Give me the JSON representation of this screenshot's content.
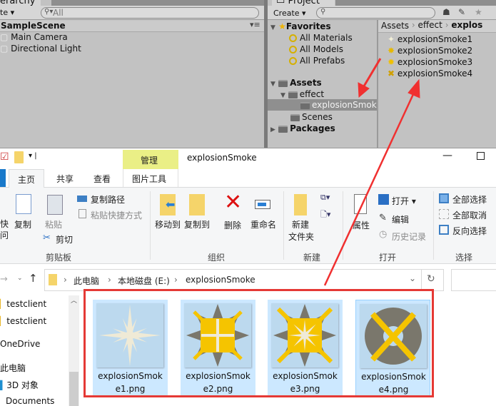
{
  "unity": {
    "hierarchy": {
      "tab_label": "erarchy",
      "create_label": "te ▾",
      "search_placeholder": "All",
      "scene": "SampleScene",
      "items": [
        "Main Camera",
        "Directional Light"
      ]
    },
    "project": {
      "tab_label": "Project",
      "create_label": "Create ▾",
      "tree": {
        "favorites": "Favorites",
        "favorite_items": [
          "All Materials",
          "All Models",
          "All Prefabs"
        ],
        "assets": "Assets",
        "effect": "effect",
        "selected_folder": "explosionSmoke",
        "scenes": "Scenes",
        "packages": "Packages"
      },
      "breadcrumb": [
        "Assets",
        "effect",
        "explos"
      ],
      "files": [
        "explosionSmoke1",
        "explosionSmoke2",
        "explosionSmoke3",
        "explosionSmoke4"
      ]
    }
  },
  "explorer": {
    "title": "explosionSmoke",
    "context_tab": "管理",
    "context_tab_color": "#eaef86",
    "tabs": [
      "主页",
      "共享",
      "查看",
      "图片工具"
    ],
    "ribbon": {
      "clipboard": {
        "label": "剪贴板",
        "pin": "快\n问",
        "copy": "复制",
        "paste": "粘贴",
        "copy_path": "复制路径",
        "paste_shortcut": "粘贴快捷方式",
        "cut": "剪切"
      },
      "organize": {
        "label": "组织",
        "move_to": "移动到",
        "copy_to": "复制到",
        "delete": "删除",
        "rename": "重命名"
      },
      "new": {
        "label": "新建",
        "new_folder_1": "新建",
        "new_folder_2": "文件夹"
      },
      "open": {
        "label": "打开",
        "properties": "属性",
        "open": "打开 ▾",
        "edit": "编辑",
        "history": "历史记录"
      },
      "select": {
        "label": "选择",
        "select_all": "全部选择",
        "select_none": "全部取消",
        "invert": "反向选择"
      }
    },
    "address": [
      "此电脑",
      "本地磁盘 (E:)",
      "explosionSmoke"
    ],
    "nav": [
      "testclient",
      "testclient",
      "OneDrive",
      "此电脑",
      "3D 对象",
      "Documents"
    ],
    "files": [
      {
        "line1": "explosionSmok",
        "line2": "e1.png"
      },
      {
        "line1": "explosionSmok",
        "line2": "e2.png"
      },
      {
        "line1": "explosionSmok",
        "line2": "e3.png"
      },
      {
        "line1": "explosionSmok",
        "line2": "e4.png"
      }
    ],
    "annotation_color": "#e53935"
  }
}
